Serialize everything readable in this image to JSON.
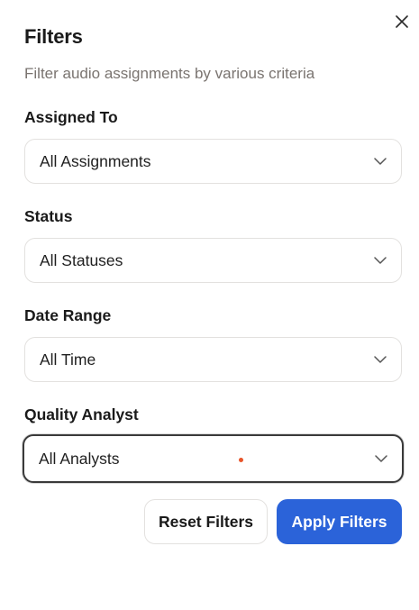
{
  "dialog": {
    "title": "Filters",
    "subtitle": "Filter audio assignments by various criteria",
    "close_icon": "close-icon"
  },
  "fields": {
    "assigned_to": {
      "label": "Assigned To",
      "value": "All Assignments"
    },
    "status": {
      "label": "Status",
      "value": "All Statuses"
    },
    "date_range": {
      "label": "Date Range",
      "value": "All Time"
    },
    "quality_analyst": {
      "label": "Quality Analyst",
      "value": "All Analysts"
    }
  },
  "actions": {
    "reset_label": "Reset Filters",
    "apply_label": "Apply Filters"
  },
  "colors": {
    "primary": "#2b63d9",
    "muted_text": "#7a7470",
    "border": "#e3e1df",
    "focus_border": "#3a3a3a",
    "indicator_dot": "#e8552a"
  }
}
